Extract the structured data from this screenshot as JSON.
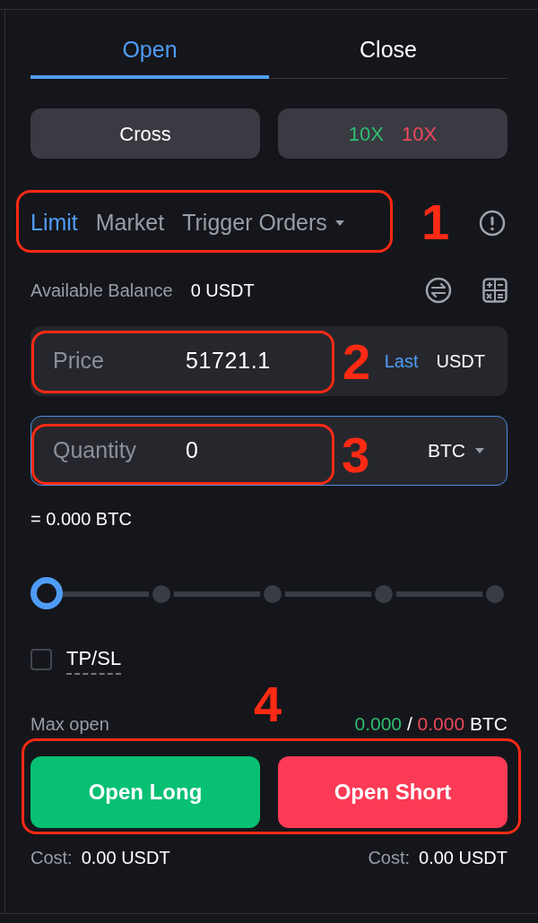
{
  "tabs": [
    {
      "label": "Open",
      "selected": true
    },
    {
      "label": "Close",
      "selected": false
    }
  ],
  "margin_mode": {
    "label": "Cross"
  },
  "leverage": {
    "long": "10X",
    "short": "10X"
  },
  "order_types": [
    {
      "label": "Limit",
      "selected": true,
      "dropdown": false
    },
    {
      "label": "Market",
      "selected": false,
      "dropdown": false
    },
    {
      "label": "Trigger Orders",
      "selected": false,
      "dropdown": true
    }
  ],
  "available_balance": {
    "label": "Available Balance",
    "value": "0 USDT"
  },
  "price_field": {
    "label": "Price",
    "value": "51721.1",
    "price_type": "Last",
    "unit": "USDT",
    "focused": false
  },
  "quantity_field": {
    "label": "Quantity",
    "value": "0",
    "unit": "BTC",
    "focused": true
  },
  "converted": "= 0.000 BTC",
  "slider": {
    "level": 0
  },
  "tp_sl": {
    "label": "TP/SL",
    "checked": false
  },
  "max_open": {
    "label": "Max open",
    "long": "0.000",
    "separator": "/",
    "short": "0.000",
    "unit": "BTC"
  },
  "actions": [
    {
      "label": "Open Long",
      "kind": "long",
      "cost_label": "Cost:",
      "cost": "0.00 USDT"
    },
    {
      "label": "Open Short",
      "kind": "short",
      "cost_label": "Cost:",
      "cost": "0.00 USDT"
    }
  ],
  "annotations": [
    {
      "label": "1"
    },
    {
      "label": "2"
    },
    {
      "label": "3"
    },
    {
      "label": "4"
    }
  ]
}
